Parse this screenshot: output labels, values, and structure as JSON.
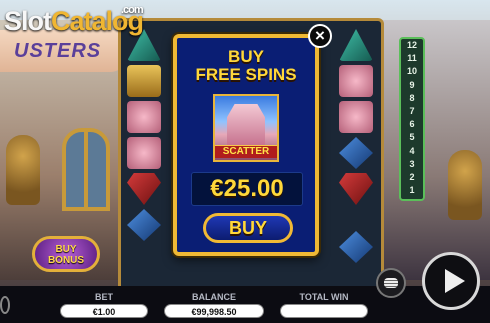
{
  "logo": {
    "part1": "Slot",
    "part2": "Catalog",
    "suffix": ".com"
  },
  "game_title": "USTERS",
  "buy_bonus": {
    "line1": "BUY",
    "line2": "BONUS"
  },
  "ladder": [
    "12",
    "11",
    "10",
    "9",
    "8",
    "7",
    "6",
    "5",
    "4",
    "3",
    "2",
    "1"
  ],
  "modal": {
    "title_line1": "BUY",
    "title_line2": "FREE SPINS",
    "symbol_label": "SCATTER",
    "price": "€25.00",
    "buy_label": "BUY",
    "close_label": "×"
  },
  "footer": {
    "bet_label": "BET",
    "bet_value": "€1.00",
    "balance_label": "BALANCE",
    "balance_value": "€99,998.50",
    "total_win_label": "TOTAL WIN",
    "total_win_value": ""
  },
  "icons": {
    "close": "close-icon",
    "spin": "play-icon",
    "coins": "coin-stack-icon",
    "info": "info-icon"
  }
}
